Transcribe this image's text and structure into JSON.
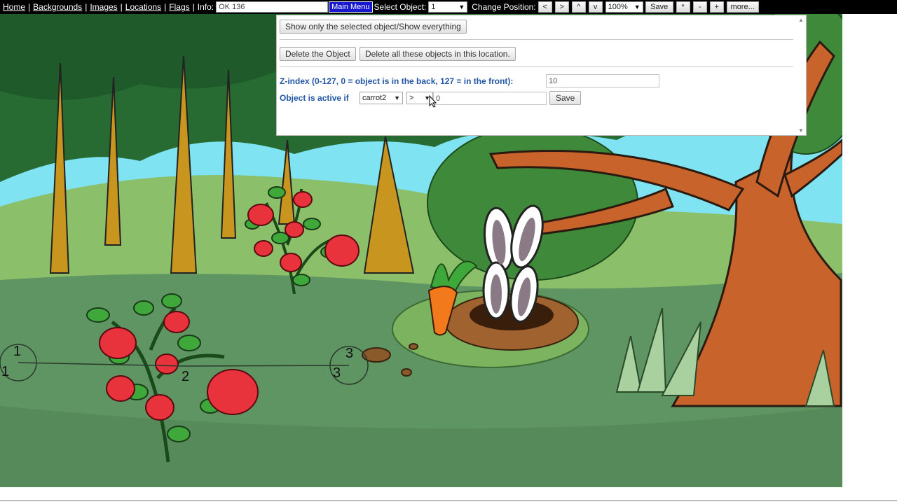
{
  "toolbar": {
    "nav": [
      "Home",
      "Backgrounds",
      "Images",
      "Locations",
      "Flags"
    ],
    "info_label": "Info:",
    "info_value": "OK 136",
    "main_menu": "Main Menu",
    "select_object_label": "Select Object:",
    "select_object_value": "1",
    "change_position_label": "Change Position:",
    "pos_left": "<",
    "pos_right": ">",
    "pos_up": "^",
    "pos_down": "v",
    "zoom": "100%",
    "save": "Save",
    "star": "*",
    "minus": "-",
    "plus": "+",
    "more": "more..."
  },
  "panel": {
    "show_toggle": "Show only the selected object/Show everything",
    "delete_object": "Delete the Object",
    "delete_all": "Delete all these objects in this location.",
    "zindex_label": "Z-index (0-127, 0 = object is in the back, 127 = in the front):",
    "zindex_value": "10",
    "active_label": "Object is active if",
    "flag_select": "carrot2",
    "operator_select": ">",
    "compare_value": "0",
    "save": "Save"
  },
  "scene": {
    "markers": [
      {
        "label": "1",
        "sub": "1"
      },
      {
        "label": "2",
        "sub": "2"
      },
      {
        "label": "3",
        "sub": "3"
      }
    ]
  },
  "colors": {
    "toolbar_bg": "#000000",
    "main_menu_bg": "#1717d0",
    "label_blue": "#2457a6",
    "grass": "#5f9463",
    "sky": "#7fe3f2"
  }
}
